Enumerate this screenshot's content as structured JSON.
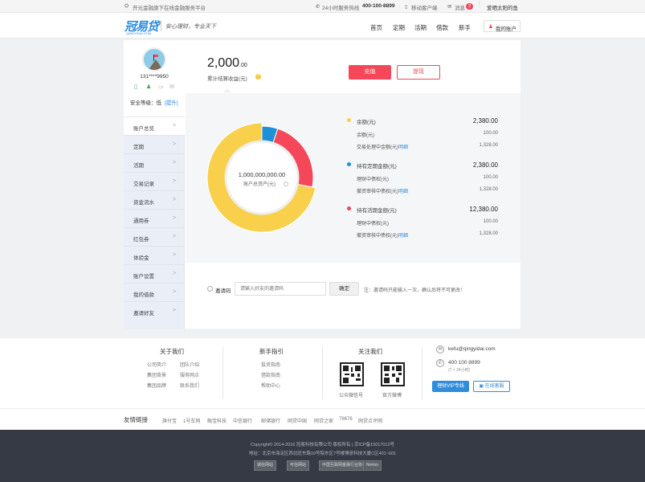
{
  "topbar": {
    "brand": "开元金融",
    "slogan": "旗下在线金融服务平台",
    "hotline_label": "24小时服务热线",
    "hotline": "400-100-8899",
    "mobile": "移动客户端",
    "messages": "消息",
    "message_count": "2",
    "username": "爱晒太阳的鱼"
  },
  "header": {
    "logo_text": "冠易贷",
    "logo_sub": "QINGYIDAI.COM",
    "tagline": "安心理财，专业天下",
    "nav": [
      "首页",
      "定期",
      "活期",
      "借款",
      "新手"
    ],
    "account_button": "我的账户"
  },
  "profile": {
    "phone": "131****9950",
    "security_label": "安全等级：低",
    "upgrade": "[提升]"
  },
  "menu": [
    "账户总览",
    "定期",
    "活期",
    "交易记录",
    "资金流水",
    "通用券",
    "红包券",
    "体验金",
    "账户设置",
    "我的借款",
    "邀请好友"
  ],
  "summary": {
    "income_int": "2,000",
    "income_dec": ".00",
    "income_label": "累计结算收益(元)",
    "recharge": "充值",
    "withdraw": "提现"
  },
  "chart_data": {
    "type": "pie",
    "title": "账户总资产(元)",
    "total": "1,000,000,000.00",
    "series": [
      {
        "name": "余额(元)",
        "value": 2380.0,
        "color": "#f8d04b"
      },
      {
        "name": "持有定期金额(元)",
        "value": 2380.0,
        "color": "#1e90d8"
      },
      {
        "name": "持有活期金额(元)",
        "value": 12380.0,
        "color": "#f4485a"
      }
    ],
    "slice_fractions": [
      0.72,
      0.05,
      0.23
    ]
  },
  "breakdown": [
    {
      "name": "余额(元)",
      "value": "2,380.00",
      "color": "#f8d04b",
      "items": [
        {
          "label": "余额(元)",
          "link": "",
          "value": "100.00"
        },
        {
          "label": "交易处理中金额(元)",
          "link": "明细",
          "value": "1,328.00"
        }
      ]
    },
    {
      "name": "持有定期金额(元)",
      "value": "2,380.00",
      "color": "#1e90d8",
      "items": [
        {
          "label": "理财中债权(元)",
          "link": "",
          "value": "100.00"
        },
        {
          "label": "撤资审核中债权(元)",
          "link": "明细",
          "value": "1,328.00"
        }
      ]
    },
    {
      "name": "持有活期金额(元)",
      "value": "12,380.00",
      "color": "#f4485a",
      "items": [
        {
          "label": "理财中债权(元)",
          "link": "",
          "value": "100.00"
        },
        {
          "label": "撤资审核中债权(元)",
          "link": "明细",
          "value": "1,328.00"
        }
      ]
    }
  ],
  "invite": {
    "label": "邀请码",
    "placeholder": "请输入好友的邀请码",
    "confirm": "确定",
    "note": "注：邀请码只能输入一次，确认后将不可更改！"
  },
  "footer": {
    "about_title": "关于我们",
    "about_links": [
      "公司简介",
      "团队介绍",
      "集团背景",
      "服务网点",
      "集团品牌",
      "联系我们"
    ],
    "guide_title": "新手指引",
    "guide_links": [
      "投资指南",
      "借款指南",
      "帮助中心"
    ],
    "follow_title": "关注我们",
    "wechat": "公众微信号",
    "weibo": "官方微博",
    "email": "kefu@qingyidai.com",
    "phone": "400 100 8899",
    "phone_hours": "(7 × 24小时)",
    "vip_button": "理财VIP专线",
    "service_button": "在线客服"
  },
  "friend_links": {
    "title": "友情链接",
    "items": [
      "旗付宝",
      "1号车网",
      "融宝科技",
      "中信银行",
      "邮储银行",
      "网贷中国",
      "网贷之家",
      "76676",
      "网贷点评网"
    ]
  },
  "bottom": {
    "copyright": "Copyright© 2014-2016 冠易科技有限公司 版权所有 | 京ICP备15017012号",
    "address": "地址：北京市海淀区西北旺东路10号院东区7号楼博彦科技大厦C区401~601",
    "badges": [
      "诚信网站",
      "可信网站",
      "中国互联网金融行业协会",
      "Norton"
    ]
  }
}
